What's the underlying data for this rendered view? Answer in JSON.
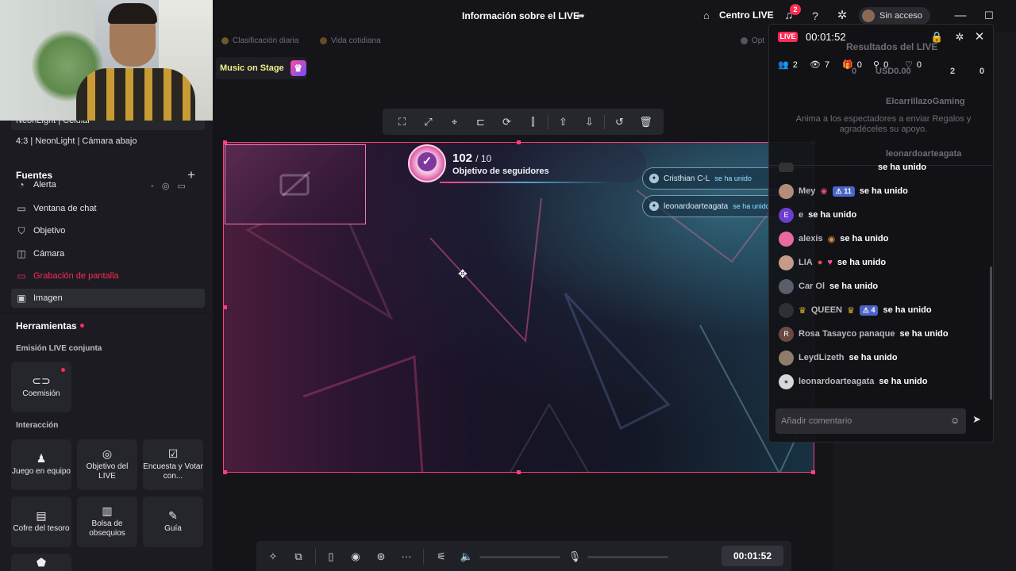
{
  "topbar": {
    "title": "Información sobre el LIVE",
    "centro_live": "Centro LIVE",
    "notifications": "2",
    "user_status": "Sin acceso"
  },
  "sidebar": {
    "scene_partial": "NeonLight | Celular",
    "scene_item": "4:3 | NeonLight | Cámara abajo",
    "sources_title": "Fuentes",
    "sources_partial": "Alerta",
    "sources": [
      {
        "label": "Ventana de chat",
        "icon": "chat-window-icon"
      },
      {
        "label": "Objetivo",
        "icon": "goal-icon"
      },
      {
        "label": "Cámara",
        "icon": "camera-icon"
      },
      {
        "label": "Grabación de pantalla",
        "icon": "screen-record-icon"
      },
      {
        "label": "Imagen",
        "icon": "image-icon"
      }
    ],
    "tools_title": "Herramientas",
    "coop_title": "Emisión LIVE conjunta",
    "coop_tools": [
      {
        "label": "Coemisión",
        "icon": "link-icon"
      }
    ],
    "interaction_title": "Interacción",
    "interaction_tools": [
      {
        "label": "Juego en equipo",
        "icon": "team-game-icon"
      },
      {
        "label": "Objetivo del LIVE",
        "icon": "live-goal-icon"
      },
      {
        "label": "Encuesta y Votar con...",
        "icon": "poll-icon"
      },
      {
        "label": "Cofre del tesoro",
        "icon": "treasure-chest-icon"
      },
      {
        "label": "Bolsa de obsequios",
        "icon": "gift-bag-icon"
      },
      {
        "label": "Guía",
        "icon": "guide-icon"
      }
    ],
    "colors": {
      "accent": "#fe2c55",
      "screen_record": "#fe2c55"
    }
  },
  "stage": {
    "chip_1": "Clasificación diaria",
    "chip_2": "Vida cotidiana",
    "chip_3": "Opt",
    "music_badge": "Music on Stage"
  },
  "goal_widget": {
    "current": "102",
    "total": "/ 10",
    "label": "Objetivo de seguidores"
  },
  "canvas_joined": [
    {
      "name": "Cristhian C-L",
      "action": "se ha unido"
    },
    {
      "name": "leonardoarteagata",
      "action": "se ha unido"
    }
  ],
  "controls": {
    "timer": "00:01:52"
  },
  "overlay": {
    "live_label": "LIVE",
    "elapsed": "00:01:52",
    "stats": {
      "viewers": "2",
      "views": "7",
      "gifts": "0",
      "shares": "0",
      "likes": "0"
    },
    "ghost": {
      "title": "Resultados del LIVE",
      "likes": "0",
      "usd": "USD0.00",
      "viewers": "2",
      "shares": "0",
      "hearts": "0",
      "user_1": "ElcarrillazoGaming",
      "hint": "Anima a los espectadores a enviar Regalos y agradéceles su apoyo.",
      "user_2": "leonardoarteagata"
    },
    "chat": [
      {
        "name": "Mey",
        "level": "11",
        "text": "se ha unido"
      },
      {
        "name": "e",
        "text": "se ha unido"
      },
      {
        "name": "alexis",
        "text": "se ha unido"
      },
      {
        "name": "LIA",
        "text": "se ha unido"
      },
      {
        "name": "Car Ol",
        "text": "se ha unido"
      },
      {
        "name": "QUEEN",
        "level": "4",
        "text": "se ha unido"
      },
      {
        "name": "Rosa Tasayco panaque",
        "text": "se ha unido"
      },
      {
        "name": "LeydLizeth",
        "text": "se ha unido"
      },
      {
        "name": "leonardoarteagata",
        "text": "se ha unido"
      }
    ],
    "chat_partial": "se ha unido",
    "comment_placeholder": "Añadir comentario"
  }
}
